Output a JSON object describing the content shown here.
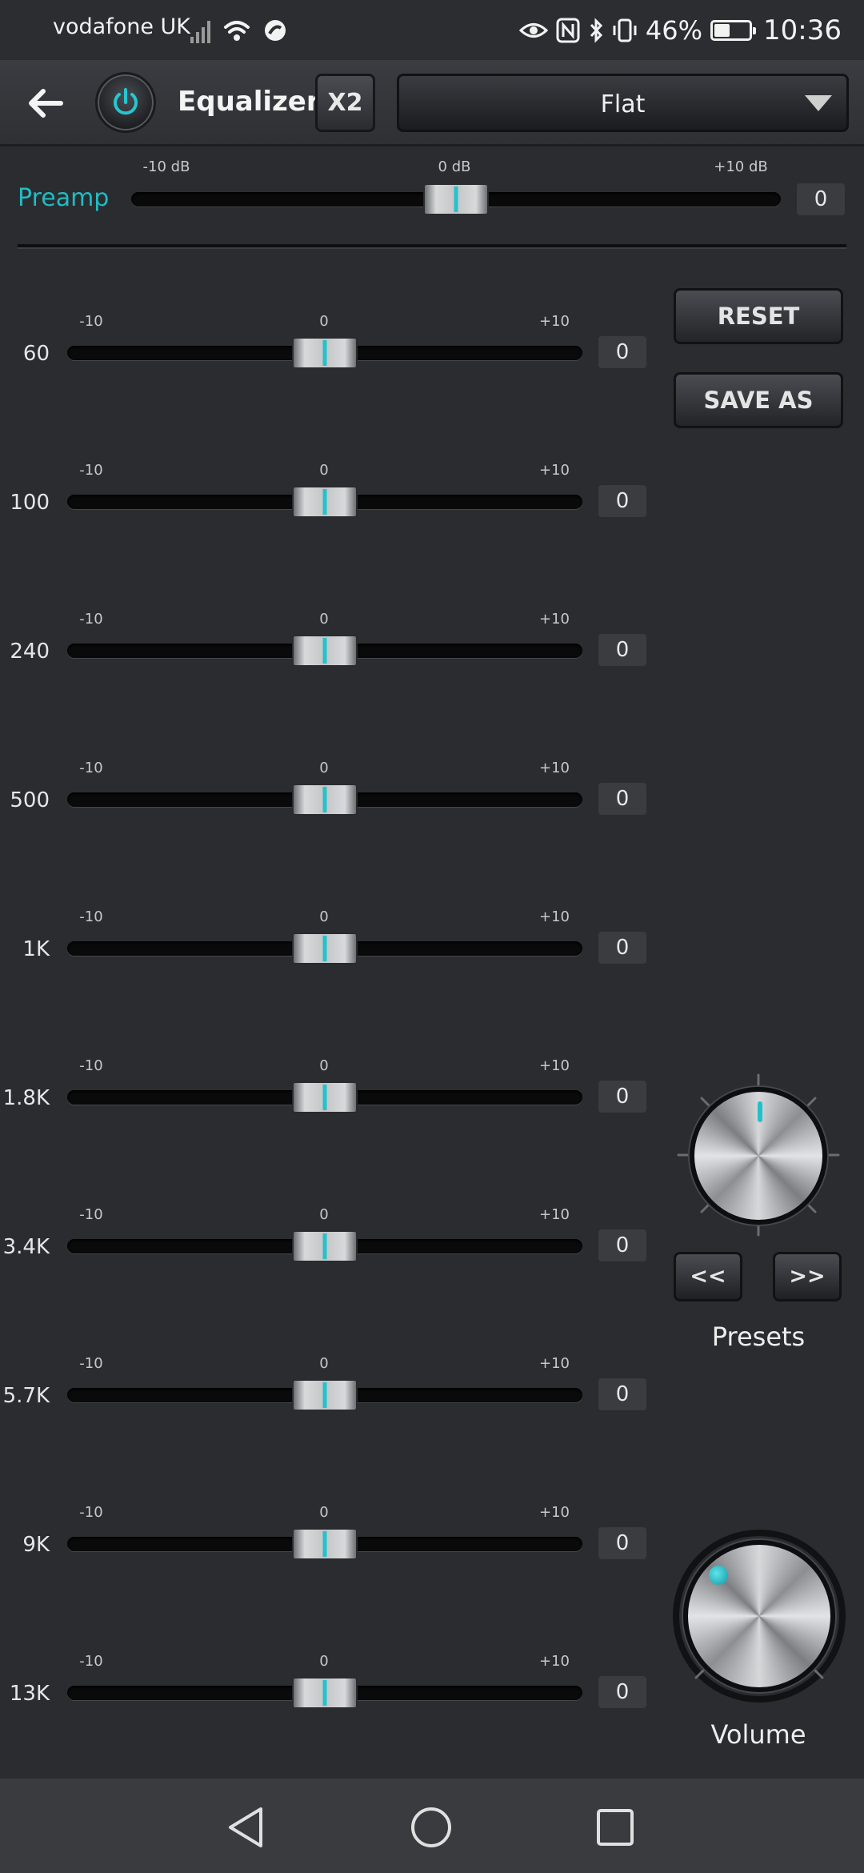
{
  "status_bar": {
    "carrier": "vodafone UK",
    "battery_percent": "46%",
    "battery_level": 0.46,
    "time": "10:36"
  },
  "header": {
    "title": "Equalizer",
    "x2_label": "X2",
    "preset_value": "Flat"
  },
  "preamp": {
    "label": "Preamp",
    "min_label": "-10 dB",
    "mid_label": "0 dB",
    "max_label": "+10 dB",
    "value": "0",
    "level": 0
  },
  "bands": [
    {
      "freq": "60",
      "min": "-10",
      "mid": "0",
      "max": "+10",
      "value": "0",
      "level": 0
    },
    {
      "freq": "100",
      "min": "-10",
      "mid": "0",
      "max": "+10",
      "value": "0",
      "level": 0
    },
    {
      "freq": "240",
      "min": "-10",
      "mid": "0",
      "max": "+10",
      "value": "0",
      "level": 0
    },
    {
      "freq": "500",
      "min": "-10",
      "mid": "0",
      "max": "+10",
      "value": "0",
      "level": 0
    },
    {
      "freq": "1K",
      "min": "-10",
      "mid": "0",
      "max": "+10",
      "value": "0",
      "level": 0
    },
    {
      "freq": "1.8K",
      "min": "-10",
      "mid": "0",
      "max": "+10",
      "value": "0",
      "level": 0
    },
    {
      "freq": "3.4K",
      "min": "-10",
      "mid": "0",
      "max": "+10",
      "value": "0",
      "level": 0
    },
    {
      "freq": "5.7K",
      "min": "-10",
      "mid": "0",
      "max": "+10",
      "value": "0",
      "level": 0
    },
    {
      "freq": "9K",
      "min": "-10",
      "mid": "0",
      "max": "+10",
      "value": "0",
      "level": 0
    },
    {
      "freq": "13K",
      "min": "-10",
      "mid": "0",
      "max": "+10",
      "value": "0",
      "level": 0
    }
  ],
  "side": {
    "reset_label": "RESET",
    "save_as_label": "SAVE AS",
    "prev_label": "<<",
    "next_label": ">>",
    "presets_label": "Presets",
    "volume_label": "Volume"
  },
  "colors": {
    "accent": "#1fbcc4",
    "background": "#2a2c30"
  },
  "icons": [
    "back-arrow-icon",
    "power-icon",
    "dropdown-caret-icon",
    "nav-back-icon",
    "nav-home-icon",
    "nav-recents-icon"
  ]
}
